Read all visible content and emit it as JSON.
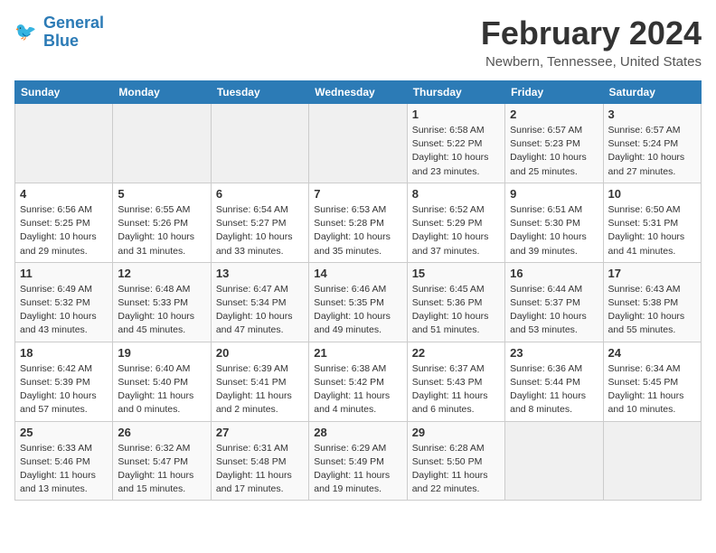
{
  "logo": {
    "text_general": "General",
    "text_blue": "Blue"
  },
  "header": {
    "month": "February 2024",
    "location": "Newbern, Tennessee, United States"
  },
  "weekdays": [
    "Sunday",
    "Monday",
    "Tuesday",
    "Wednesday",
    "Thursday",
    "Friday",
    "Saturday"
  ],
  "weeks": [
    [
      {
        "day": "",
        "sunrise": "",
        "sunset": "",
        "daylight": ""
      },
      {
        "day": "",
        "sunrise": "",
        "sunset": "",
        "daylight": ""
      },
      {
        "day": "",
        "sunrise": "",
        "sunset": "",
        "daylight": ""
      },
      {
        "day": "",
        "sunrise": "",
        "sunset": "",
        "daylight": ""
      },
      {
        "day": "1",
        "sunrise": "Sunrise: 6:58 AM",
        "sunset": "Sunset: 5:22 PM",
        "daylight": "Daylight: 10 hours and 23 minutes."
      },
      {
        "day": "2",
        "sunrise": "Sunrise: 6:57 AM",
        "sunset": "Sunset: 5:23 PM",
        "daylight": "Daylight: 10 hours and 25 minutes."
      },
      {
        "day": "3",
        "sunrise": "Sunrise: 6:57 AM",
        "sunset": "Sunset: 5:24 PM",
        "daylight": "Daylight: 10 hours and 27 minutes."
      }
    ],
    [
      {
        "day": "4",
        "sunrise": "Sunrise: 6:56 AM",
        "sunset": "Sunset: 5:25 PM",
        "daylight": "Daylight: 10 hours and 29 minutes."
      },
      {
        "day": "5",
        "sunrise": "Sunrise: 6:55 AM",
        "sunset": "Sunset: 5:26 PM",
        "daylight": "Daylight: 10 hours and 31 minutes."
      },
      {
        "day": "6",
        "sunrise": "Sunrise: 6:54 AM",
        "sunset": "Sunset: 5:27 PM",
        "daylight": "Daylight: 10 hours and 33 minutes."
      },
      {
        "day": "7",
        "sunrise": "Sunrise: 6:53 AM",
        "sunset": "Sunset: 5:28 PM",
        "daylight": "Daylight: 10 hours and 35 minutes."
      },
      {
        "day": "8",
        "sunrise": "Sunrise: 6:52 AM",
        "sunset": "Sunset: 5:29 PM",
        "daylight": "Daylight: 10 hours and 37 minutes."
      },
      {
        "day": "9",
        "sunrise": "Sunrise: 6:51 AM",
        "sunset": "Sunset: 5:30 PM",
        "daylight": "Daylight: 10 hours and 39 minutes."
      },
      {
        "day": "10",
        "sunrise": "Sunrise: 6:50 AM",
        "sunset": "Sunset: 5:31 PM",
        "daylight": "Daylight: 10 hours and 41 minutes."
      }
    ],
    [
      {
        "day": "11",
        "sunrise": "Sunrise: 6:49 AM",
        "sunset": "Sunset: 5:32 PM",
        "daylight": "Daylight: 10 hours and 43 minutes."
      },
      {
        "day": "12",
        "sunrise": "Sunrise: 6:48 AM",
        "sunset": "Sunset: 5:33 PM",
        "daylight": "Daylight: 10 hours and 45 minutes."
      },
      {
        "day": "13",
        "sunrise": "Sunrise: 6:47 AM",
        "sunset": "Sunset: 5:34 PM",
        "daylight": "Daylight: 10 hours and 47 minutes."
      },
      {
        "day": "14",
        "sunrise": "Sunrise: 6:46 AM",
        "sunset": "Sunset: 5:35 PM",
        "daylight": "Daylight: 10 hours and 49 minutes."
      },
      {
        "day": "15",
        "sunrise": "Sunrise: 6:45 AM",
        "sunset": "Sunset: 5:36 PM",
        "daylight": "Daylight: 10 hours and 51 minutes."
      },
      {
        "day": "16",
        "sunrise": "Sunrise: 6:44 AM",
        "sunset": "Sunset: 5:37 PM",
        "daylight": "Daylight: 10 hours and 53 minutes."
      },
      {
        "day": "17",
        "sunrise": "Sunrise: 6:43 AM",
        "sunset": "Sunset: 5:38 PM",
        "daylight": "Daylight: 10 hours and 55 minutes."
      }
    ],
    [
      {
        "day": "18",
        "sunrise": "Sunrise: 6:42 AM",
        "sunset": "Sunset: 5:39 PM",
        "daylight": "Daylight: 10 hours and 57 minutes."
      },
      {
        "day": "19",
        "sunrise": "Sunrise: 6:40 AM",
        "sunset": "Sunset: 5:40 PM",
        "daylight": "Daylight: 11 hours and 0 minutes."
      },
      {
        "day": "20",
        "sunrise": "Sunrise: 6:39 AM",
        "sunset": "Sunset: 5:41 PM",
        "daylight": "Daylight: 11 hours and 2 minutes."
      },
      {
        "day": "21",
        "sunrise": "Sunrise: 6:38 AM",
        "sunset": "Sunset: 5:42 PM",
        "daylight": "Daylight: 11 hours and 4 minutes."
      },
      {
        "day": "22",
        "sunrise": "Sunrise: 6:37 AM",
        "sunset": "Sunset: 5:43 PM",
        "daylight": "Daylight: 11 hours and 6 minutes."
      },
      {
        "day": "23",
        "sunrise": "Sunrise: 6:36 AM",
        "sunset": "Sunset: 5:44 PM",
        "daylight": "Daylight: 11 hours and 8 minutes."
      },
      {
        "day": "24",
        "sunrise": "Sunrise: 6:34 AM",
        "sunset": "Sunset: 5:45 PM",
        "daylight": "Daylight: 11 hours and 10 minutes."
      }
    ],
    [
      {
        "day": "25",
        "sunrise": "Sunrise: 6:33 AM",
        "sunset": "Sunset: 5:46 PM",
        "daylight": "Daylight: 11 hours and 13 minutes."
      },
      {
        "day": "26",
        "sunrise": "Sunrise: 6:32 AM",
        "sunset": "Sunset: 5:47 PM",
        "daylight": "Daylight: 11 hours and 15 minutes."
      },
      {
        "day": "27",
        "sunrise": "Sunrise: 6:31 AM",
        "sunset": "Sunset: 5:48 PM",
        "daylight": "Daylight: 11 hours and 17 minutes."
      },
      {
        "day": "28",
        "sunrise": "Sunrise: 6:29 AM",
        "sunset": "Sunset: 5:49 PM",
        "daylight": "Daylight: 11 hours and 19 minutes."
      },
      {
        "day": "29",
        "sunrise": "Sunrise: 6:28 AM",
        "sunset": "Sunset: 5:50 PM",
        "daylight": "Daylight: 11 hours and 22 minutes."
      },
      {
        "day": "",
        "sunrise": "",
        "sunset": "",
        "daylight": ""
      },
      {
        "day": "",
        "sunrise": "",
        "sunset": "",
        "daylight": ""
      }
    ]
  ]
}
